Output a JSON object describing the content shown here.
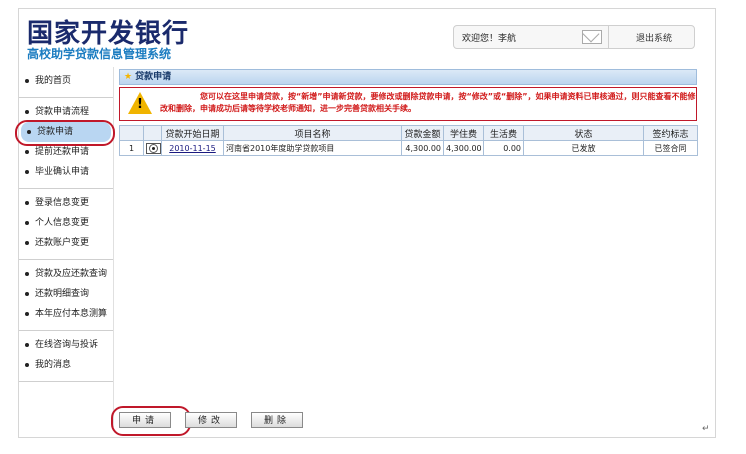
{
  "header": {
    "bank_name": "国家开发银行",
    "system_name": "高校助学贷款信息管理系统",
    "welcome": "欢迎您！李航",
    "logout": "退出系统"
  },
  "sidebar": {
    "groups": [
      {
        "items": [
          {
            "label": "我的首页"
          }
        ]
      },
      {
        "items": [
          {
            "label": "贷款申请流程"
          },
          {
            "label": "贷款申请",
            "active": true
          },
          {
            "label": "提前还款申请"
          },
          {
            "label": "毕业确认申请"
          }
        ]
      },
      {
        "items": [
          {
            "label": "登录信息变更"
          },
          {
            "label": "个人信息变更"
          },
          {
            "label": "还款账户变更"
          }
        ]
      },
      {
        "items": [
          {
            "label": "贷款及应还款查询"
          },
          {
            "label": "还款明细查询"
          },
          {
            "label": "本年应付本息测算"
          }
        ]
      },
      {
        "items": [
          {
            "label": "在线咨询与投诉"
          },
          {
            "label": "我的消息"
          }
        ]
      }
    ]
  },
  "panel": {
    "title": "贷款申请",
    "notice": "您可以在这里申请贷款，按“新增”申请新贷款，要修改或删除贷款申请，按“修改”或“删除”，如果申请资料已审核通过，则只能查看不能修改和删除，申请成功后请等待学校老师通知，进一步完善贷款相关手续。"
  },
  "table": {
    "headers": [
      "",
      "",
      "贷款开始日期",
      "项目名称",
      "贷款金额",
      "学住费",
      "生活费",
      "状态",
      "签约标志"
    ],
    "rows": [
      {
        "index": "1",
        "start_date": "2010-11-15",
        "project": "河南省2010年度助学贷款项目",
        "amount": "4,300.00",
        "tuition": "4,300.00",
        "living": "0.00",
        "status": "已发放",
        "sign": "已签合同"
      }
    ]
  },
  "buttons": {
    "apply": "申请",
    "edit": "修改",
    "delete": "删除"
  },
  "colors": {
    "accent_red": "#c0182a",
    "brand_blue": "#1c7dc1",
    "notice_text": "#d11a1a"
  }
}
